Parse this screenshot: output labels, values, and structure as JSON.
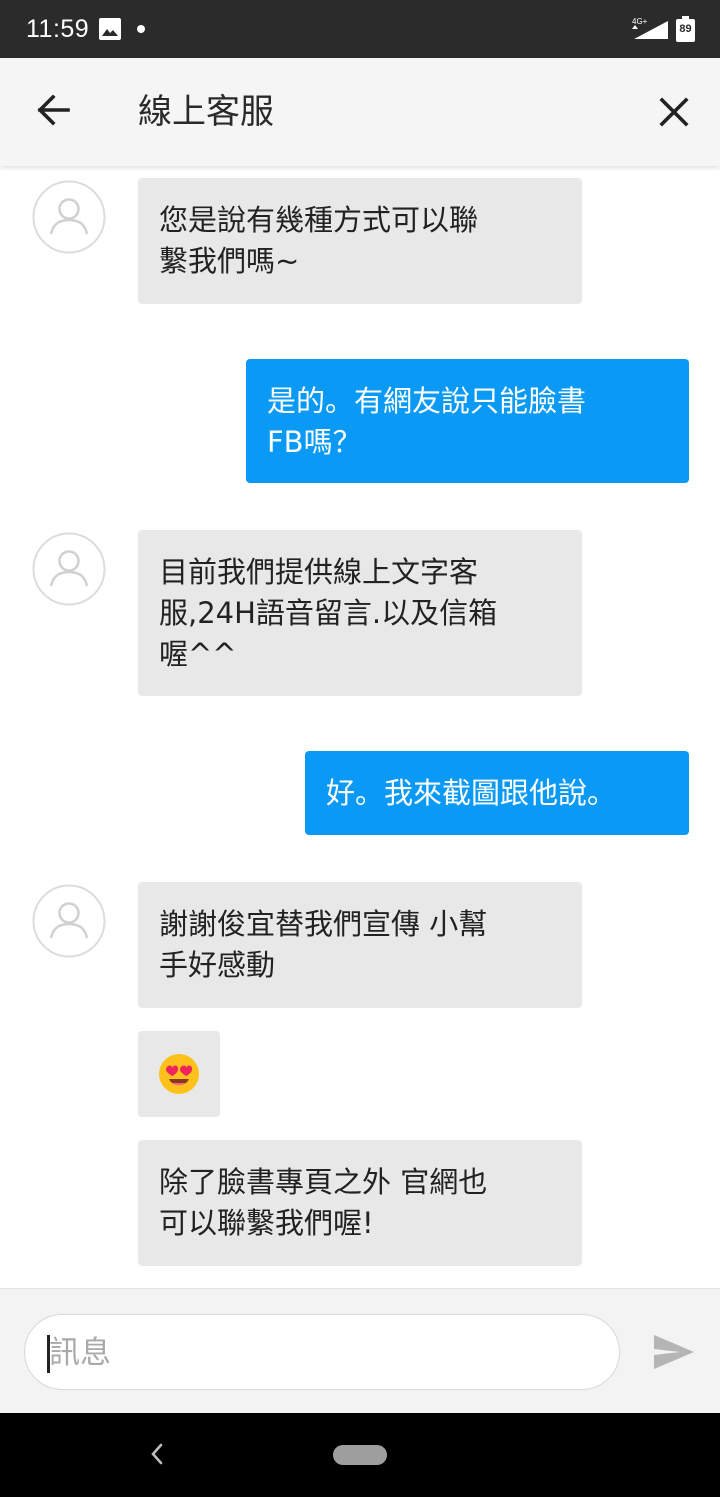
{
  "status_bar": {
    "time": "11:59",
    "network": "4G+",
    "battery": "89",
    "icons": [
      "gallery-icon",
      "notification-dot",
      "signal-icon",
      "battery-icon"
    ]
  },
  "header": {
    "title": "線上客服",
    "back_icon": "arrow-left-icon",
    "close_icon": "close-icon"
  },
  "messages": [
    {
      "sender": "agent",
      "text": "您是說有幾種方式可以聯\n繫我們嗎~"
    },
    {
      "sender": "user",
      "text": "是的。有網友說只能臉書\nFB嗎？"
    },
    {
      "sender": "agent",
      "text": "目前我們提供線上文字客\n服,24H語音留言.以及信箱\n喔^^"
    },
    {
      "sender": "user",
      "text": "好。我來截圖跟他說。"
    },
    {
      "sender": "agent",
      "text": "謝謝俊宜替我們宣傳  小幫\n手好感動"
    },
    {
      "sender": "agent",
      "type": "emoji",
      "emoji": "smiling-face-with-heart-eyes"
    },
    {
      "sender": "agent",
      "text": "除了臉書專頁之外  官網也\n可以聯繫我們喔!"
    }
  ],
  "input": {
    "placeholder": "訊息",
    "value": "",
    "send_icon": "send-icon"
  },
  "nav_bar": {
    "icons": [
      "nav-back-icon",
      "home-pill"
    ]
  },
  "colors": {
    "user_bubble": "#0a99f4",
    "agent_bubble": "#e8e8e8",
    "header_bg": "#f5f5f5",
    "status_bar_bg": "#2b2b2b"
  }
}
